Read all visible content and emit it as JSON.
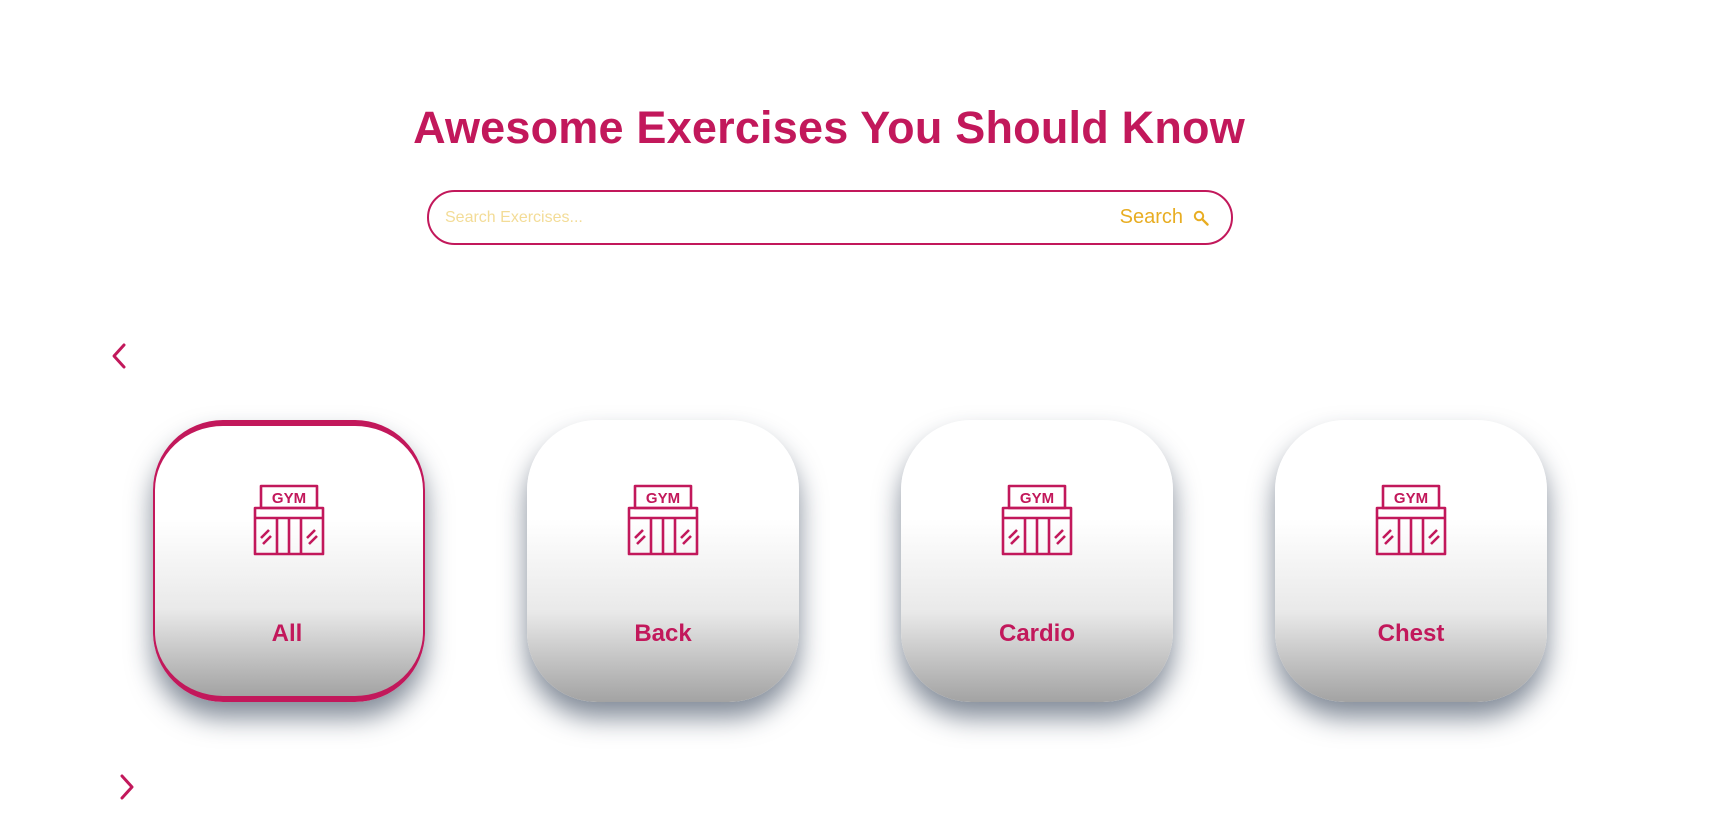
{
  "header": {
    "title": "Awesome Exercises You Should Know"
  },
  "search": {
    "placeholder": "Search Exercises...",
    "button_label": "Search",
    "button_icon": "search-icon"
  },
  "carousel": {
    "prev_icon": "chevron-left-icon",
    "next_icon": "chevron-right-icon",
    "selected": "All",
    "items": [
      {
        "label": "All",
        "icon": "gym-icon",
        "active": true
      },
      {
        "label": "Back",
        "icon": "gym-icon",
        "active": false
      },
      {
        "label": "Cardio",
        "icon": "gym-icon",
        "active": false
      },
      {
        "label": "Chest",
        "icon": "gym-icon",
        "active": false
      }
    ]
  },
  "colors": {
    "primary": "#c2185b",
    "accent": "#e8ad22",
    "placeholder": "#f3dc97"
  }
}
